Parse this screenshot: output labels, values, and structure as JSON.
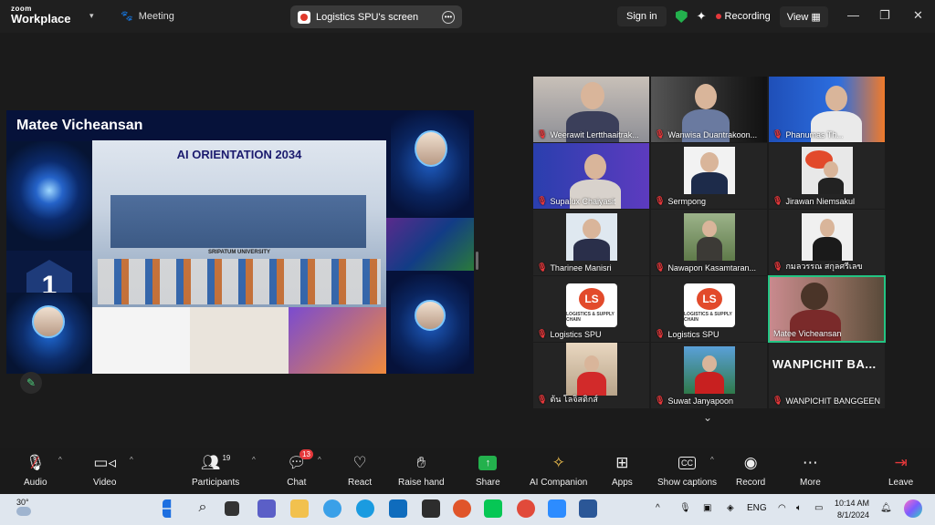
{
  "titlebar": {
    "logo_line1": "zoom",
    "logo_line2": "Workplace",
    "meeting_label": "Meeting",
    "share_pill_label": "Logistics SPU's screen",
    "signin_label": "Sign in",
    "recording_label": "Recording",
    "view_label": "View"
  },
  "shared_screen": {
    "presenter_name": "Matee Vicheansan",
    "banner_title": "AI ORIENTATION 2034",
    "banner_sub": "SRIPATUM UNIVERSITY",
    "slide_number": "1"
  },
  "gallery": [
    {
      "name": "Weerawit Lertthaaitrak...",
      "muted": true
    },
    {
      "name": "Wanwisa Duantrakoon...",
      "muted": true
    },
    {
      "name": "Phanumas Th...",
      "muted": true
    },
    {
      "name": "Supalux Chaiyasit",
      "muted": true
    },
    {
      "name": "Sermpong",
      "muted": true
    },
    {
      "name": "Jirawan Niemsakul",
      "muted": true
    },
    {
      "name": "Tharinee Manisri",
      "muted": true
    },
    {
      "name": "Nawapon Kasamtaran...",
      "muted": true
    },
    {
      "name": "กมลวรรณ สกุลศรีเลข",
      "muted": true
    },
    {
      "name": "Logistics SPU",
      "muted": true
    },
    {
      "name": "Logistics SPU",
      "muted": true
    },
    {
      "name": "Matee Vicheansan",
      "muted": false,
      "active": true
    },
    {
      "name": "ต้น โลจิสติกส์",
      "muted": true
    },
    {
      "name": "Suwat Janyapoon",
      "muted": true
    },
    {
      "name": "WANPICHIT BANGGEEN",
      "muted": true,
      "display_text": "WANPICHIT BA..."
    }
  ],
  "toolbar": {
    "audio": "Audio",
    "video": "Video",
    "participants": "Participants",
    "participants_count": "19",
    "chat": "Chat",
    "chat_badge": "13",
    "react": "React",
    "raise_hand": "Raise hand",
    "share": "Share",
    "ai_companion": "AI Companion",
    "apps": "Apps",
    "show_captions": "Show captions",
    "record": "Record",
    "more": "More",
    "leave": "Leave"
  },
  "taskbar": {
    "temperature": "30°",
    "lang": "ENG",
    "time": "10:14 AM",
    "date": "8/1/2024"
  },
  "colors": {
    "accent_green": "#23c483",
    "record_red": "#e5383b",
    "share_green": "#23b14d"
  }
}
